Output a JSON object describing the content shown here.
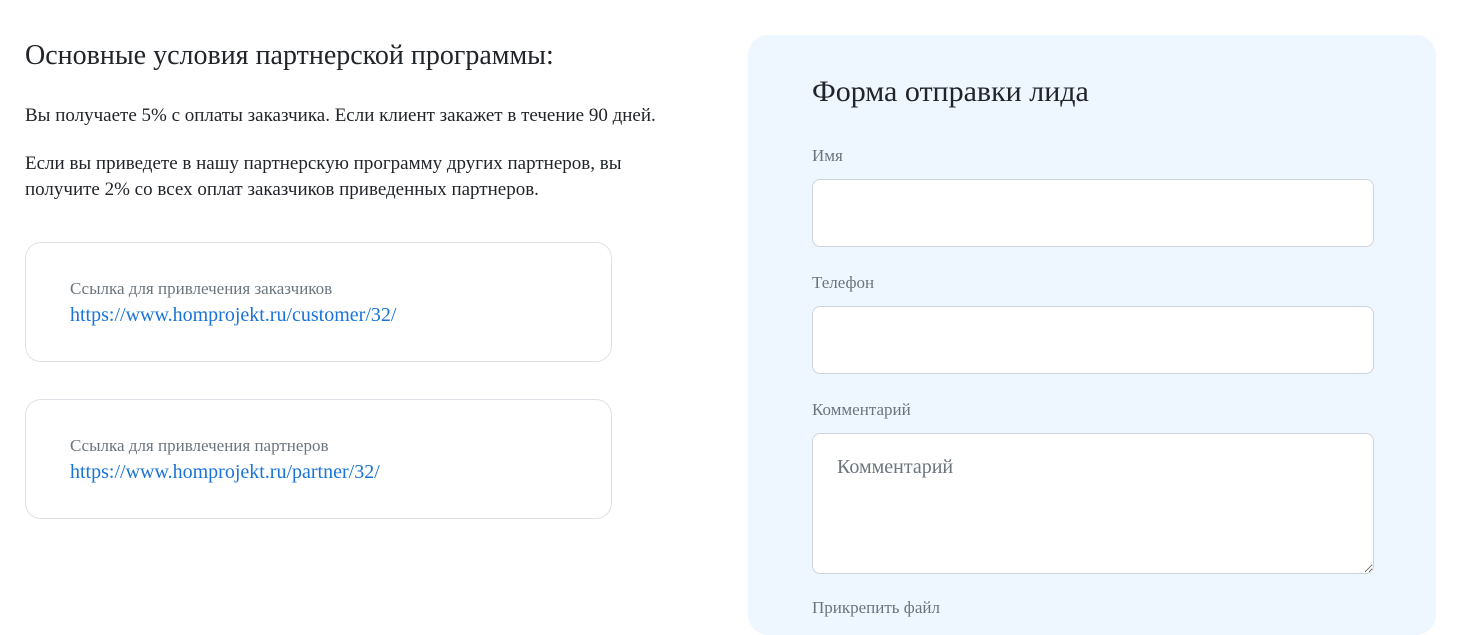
{
  "conditions": {
    "title": "Основные условия партнерской программы:",
    "paragraph1": "Вы получаете 5% с оплаты заказчика. Если клиент закажет в течение 90 дней.",
    "paragraph2": "Если вы приведете в нашу партнерскую программу других партнеров, вы получите 2% со всех оплат заказчиков приведенных партнеров."
  },
  "links": {
    "customer": {
      "label": "Ссылка для привлечения заказчиков",
      "url": "https://www.homprojekt.ru/customer/32/"
    },
    "partner": {
      "label": "Ссылка для привлечения партнеров",
      "url": "https://www.homprojekt.ru/partner/32/"
    }
  },
  "lead_form": {
    "title": "Форма отправки лида",
    "name_label": "Имя",
    "name_value": "",
    "phone_label": "Телефон",
    "phone_value": "",
    "comment_label": "Комментарий",
    "comment_placeholder": "Комментарий",
    "comment_value": "",
    "file_label": "Прикрепить файл"
  },
  "colors": {
    "link": "#1a73d9",
    "form_background": "#eef6ff",
    "muted_text": "#6c757d"
  }
}
